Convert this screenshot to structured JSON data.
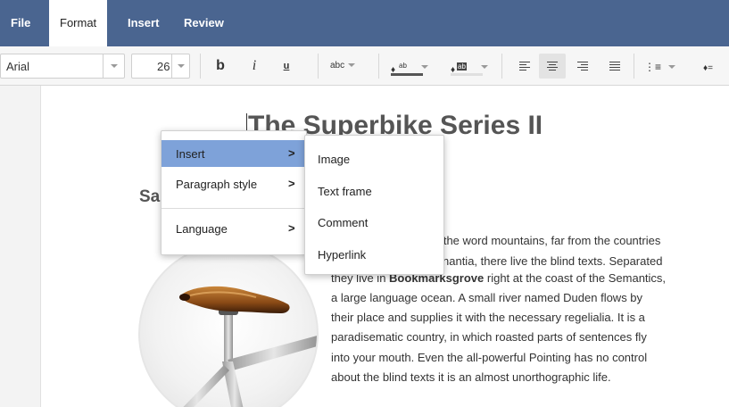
{
  "menu": {
    "tabs": [
      "File",
      "Format",
      "Insert",
      "Review"
    ],
    "active_tab": "Format"
  },
  "toolbar": {
    "font_name": "Arial",
    "font_size": "26",
    "bold_label": "b",
    "italic_label": "i",
    "underline_label": "u",
    "strike_label": "abc",
    "fill_color_label": "ab",
    "highlight_color_label": "ab"
  },
  "document": {
    "title": "The Superbike Series II",
    "subheading": "Sa",
    "body_lines": [
      "d the word mountains, far from the countries",
      "nantia, there live the blind texts. Separated",
      "they live in Bookmarksgrove right at the coast of the Semantics,",
      "a large language ocean. A small river named Duden flows by",
      "their place and supplies it with the necessary regelialia. It is a",
      "paradisematic country, in which roasted parts of sentences fly",
      "into your mouth. Even the all-powerful Pointing has no control",
      "about the blind texts it is an almost unorthographic life."
    ],
    "bold_word": "Bookmarksgrove"
  },
  "context_menu": {
    "items": [
      {
        "label": "Insert",
        "arrow": ">"
      },
      {
        "label": "Paragraph style",
        "arrow": ">"
      },
      {
        "label": "Language",
        "arrow": ">"
      }
    ]
  },
  "submenu": {
    "items": [
      "Image",
      "Text frame",
      "Comment",
      "Hyperlink"
    ]
  },
  "colors": {
    "menubar": "#4a6590",
    "hover": "#7ea2d9",
    "fill_underline": "#555555",
    "highlight_underline": "#e0e0e0"
  }
}
